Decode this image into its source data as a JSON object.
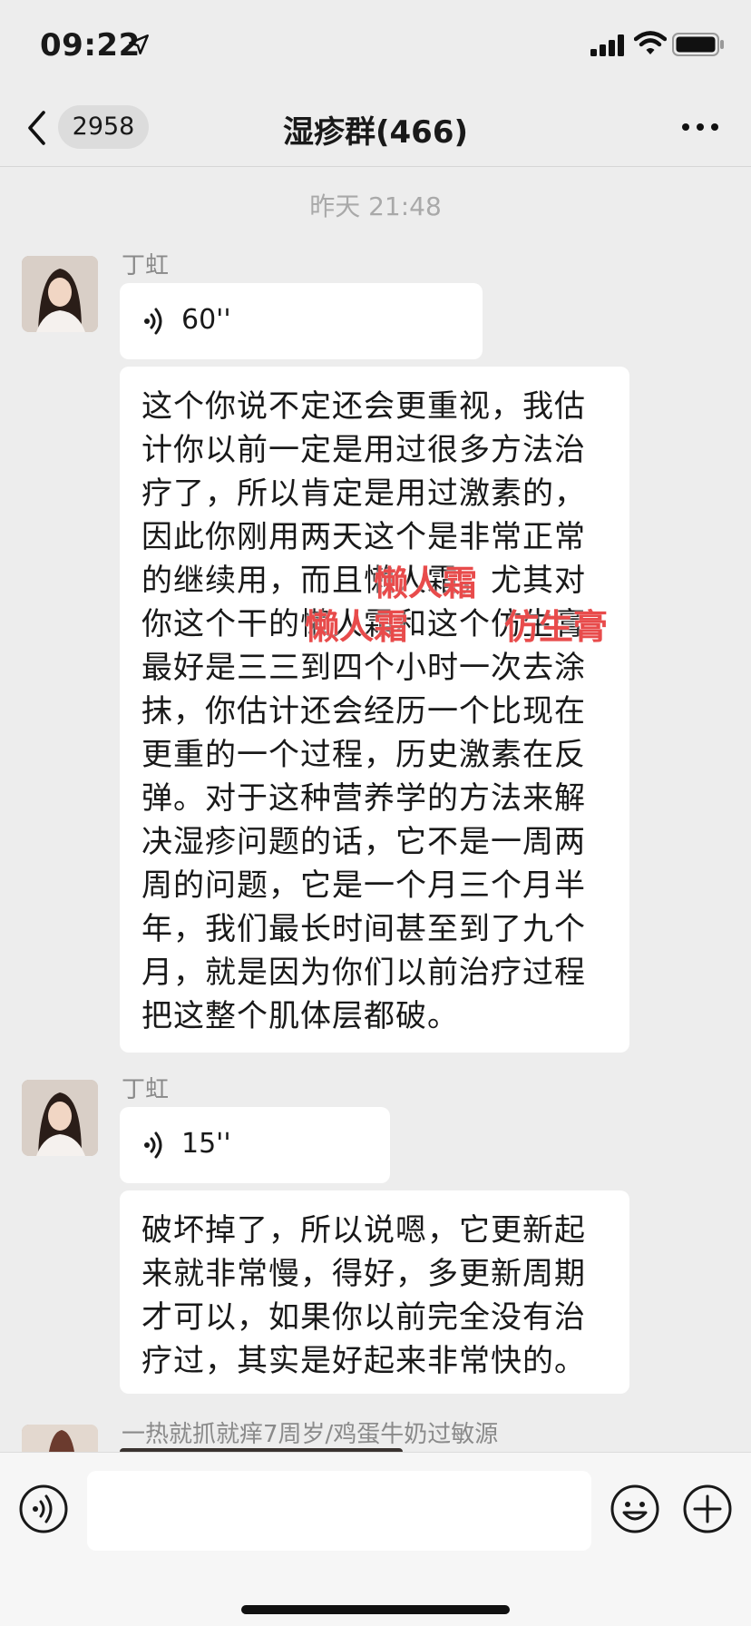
{
  "status_bar": {
    "time": "09:22"
  },
  "nav": {
    "unread_count": "2958",
    "title": "湿疹群(466)"
  },
  "chat": {
    "timestamp": "昨天 21:48",
    "messages": [
      {
        "sender": "丁虹",
        "voice_duration": "60''",
        "text_lines": [
          "这个你说不定还会更重视，我估",
          "计你以前一定是用过很多方法治",
          "疗了，所以肯定是用过激素的，",
          "因此你刚用两天这个是非常正常",
          "的继续用，而且懒人霜，尤其对",
          "你这个干的懒人霜和这个仿生膏",
          "最好是三三到四个小时一次去涂",
          "抹，你估计还会经历一个比现在",
          "更重的一个过程，历史激素在反",
          "弹。对于这种营养学的方法来解",
          "决湿疹问题的话，它不是一周两",
          "周的问题，它是一个月三个月半",
          "年，我们最长时间甚至到了九个",
          "月，就是因为你们以前治疗过程",
          "把这整个肌体层都破。"
        ],
        "overlays": [
          "懒人霜",
          "懒人霜",
          "仿生膏"
        ]
      },
      {
        "sender": "丁虹",
        "voice_duration": "15''",
        "text_lines": [
          "破坏掉了，所以说嗯，它更新起",
          "来就非常慢，得好，多更新周期",
          "才可以，如果你以前完全没有治",
          "疗过，其实是好起来非常快的。"
        ]
      },
      {
        "sender": "一热就抓就痒7周岁/鸡蛋牛奶过敏源"
      }
    ]
  },
  "colors": {
    "overlay_red": "#e84b4b",
    "bubble": "#ffffff",
    "background": "#ededed"
  }
}
